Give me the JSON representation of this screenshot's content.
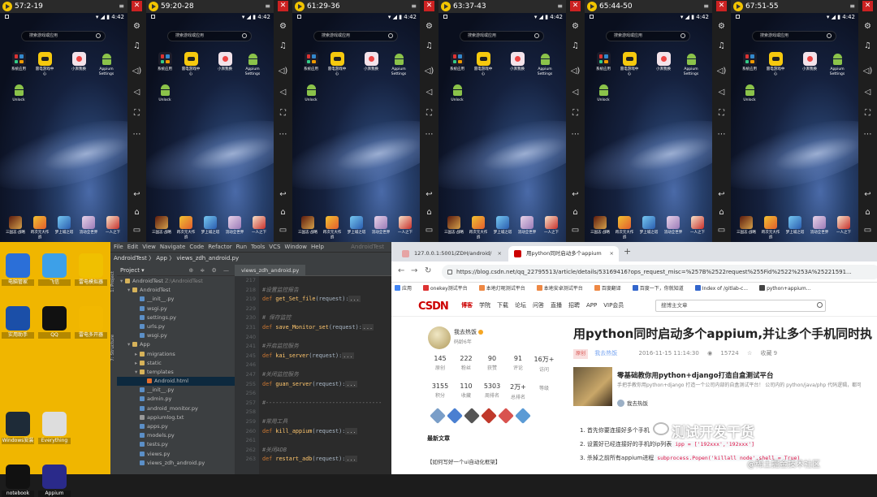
{
  "emulators": [
    {
      "title": "57:2-19",
      "time": "4:42"
    },
    {
      "title": "59:20-28",
      "time": "4:42"
    },
    {
      "title": "61:29-36",
      "time": "4:42"
    },
    {
      "title": "63:37-43",
      "time": "4:42"
    },
    {
      "title": "65:44-50",
      "time": "4:42"
    },
    {
      "title": "67:51-55",
      "time": "4:42"
    }
  ],
  "android": {
    "search_placeholder": "搜索游戏或应用",
    "apps": [
      "系统应用",
      "雷电游戏中心",
      "小湃我换",
      "Appium Settings",
      "Unlock"
    ],
    "dock": [
      "三国志·战略",
      "跨次元大作战",
      "梦上城之塔",
      "流动全世界",
      "一人之下"
    ]
  },
  "desktop": {
    "icons": [
      "电脑管家",
      "飞信",
      "雷电模拟器",
      "实用助手",
      "QQ",
      "雷电多开器",
      "Windows安装",
      "Everything",
      "notebook",
      "Appium"
    ]
  },
  "ide": {
    "menu": [
      "File",
      "Edit",
      "View",
      "Navigate",
      "Code",
      "Refactor",
      "Run",
      "Tools",
      "VCS",
      "Window",
      "Help"
    ],
    "menu_right": "AndroidTest",
    "crumbs": "AndroidTest 〉 App 〉 views_zdh_android.py",
    "project_label": "Project",
    "tree": [
      {
        "name": "AndroidTest",
        "sub": "Z:\\AndroidTest",
        "type": "folder",
        "indent": 0,
        "arrow": "▾"
      },
      {
        "name": "AndroidTest",
        "type": "folder",
        "indent": 1,
        "arrow": "▾"
      },
      {
        "name": "__init__.py",
        "type": "py",
        "indent": 2,
        "arrow": ""
      },
      {
        "name": "wsgi.py",
        "type": "py",
        "indent": 2,
        "arrow": ""
      },
      {
        "name": "settings.py",
        "type": "py",
        "indent": 2,
        "arrow": ""
      },
      {
        "name": "urls.py",
        "type": "py",
        "indent": 2,
        "arrow": ""
      },
      {
        "name": "wsgi.py",
        "type": "py",
        "indent": 2,
        "arrow": ""
      },
      {
        "name": "App",
        "type": "folder",
        "indent": 1,
        "arrow": "▾"
      },
      {
        "name": "migrations",
        "type": "folder",
        "indent": 2,
        "arrow": "▸"
      },
      {
        "name": "static",
        "type": "folder",
        "indent": 2,
        "arrow": "▸"
      },
      {
        "name": "templates",
        "type": "folder",
        "indent": 2,
        "arrow": "▾"
      },
      {
        "name": "Android.html",
        "type": "html",
        "indent": 3,
        "arrow": ""
      },
      {
        "name": "__init__.py",
        "type": "py",
        "indent": 2,
        "arrow": ""
      },
      {
        "name": "admin.py",
        "type": "py",
        "indent": 2,
        "arrow": ""
      },
      {
        "name": "android_monitor.py",
        "type": "py",
        "indent": 2,
        "arrow": ""
      },
      {
        "name": "appiumlog.txt",
        "type": "txt",
        "indent": 2,
        "arrow": ""
      },
      {
        "name": "apps.py",
        "type": "py",
        "indent": 2,
        "arrow": ""
      },
      {
        "name": "models.py",
        "type": "py",
        "indent": 2,
        "arrow": ""
      },
      {
        "name": "tests.py",
        "type": "py",
        "indent": 2,
        "arrow": ""
      },
      {
        "name": "views.py",
        "type": "py",
        "indent": 2,
        "arrow": ""
      },
      {
        "name": "views_zdh_android.py",
        "type": "py",
        "indent": 2,
        "arrow": ""
      }
    ],
    "selected_index": 11,
    "editor_tab": "views_zdh_android.py",
    "line_numbers": [
      "217",
      "218",
      "219",
      "229",
      "230",
      "231",
      "240",
      "241",
      "245",
      "246",
      "247",
      "255",
      "256",
      "257",
      "258",
      "259",
      "260",
      "261",
      "262",
      "263"
    ],
    "code": [
      "",
      "#设置监控报告",
      "def get_Set_file(request):",
      "",
      "# 保存监控",
      "def save_Monitor_set(request):",
      "",
      "#开启监控服务",
      "def kai_server(request):",
      "",
      "#关闭监控服务",
      "def guan_server(request):",
      "",
      "#-----------------------------------",
      "",
      "#常用工具",
      "def kill_appium(request):",
      "",
      "#关闭ADB",
      "def restart_adb(request):"
    ]
  },
  "browser": {
    "tabs": [
      {
        "title": "127.0.0.1:5001/ZDH/android/",
        "active": false
      },
      {
        "title": "用python同时启动多个appium",
        "active": true
      }
    ],
    "url": "https://blog.csdn.net/qq_22795513/article/details/53169416?ops_request_misc=%257B%2522request%255Fid%2522%253A%25221591...",
    "bookmarks": [
      "应用",
      "onekey测试平台",
      "本地灯呢测试平台",
      "本地安卓测试平台",
      "百度翻译",
      "百度一下，你就知道",
      "Index of /gitlab-c...",
      "python+appium..."
    ],
    "csdn_nav": [
      "博客",
      "学院",
      "下载",
      "论坛",
      "问答",
      "直播",
      "招聘",
      "APP",
      "VIP会员"
    ],
    "search_placeholder": "搜博主文章",
    "author": "我去热饭",
    "author_age": "码龄6年",
    "stats": [
      {
        "n": "145",
        "l": "原创"
      },
      {
        "n": "222",
        "l": "粉丝"
      },
      {
        "n": "90",
        "l": "获赞"
      },
      {
        "n": "91",
        "l": "评论"
      },
      {
        "n": "16万+",
        "l": "访问"
      },
      {
        "n": "3155",
        "l": "积分"
      },
      {
        "n": "110",
        "l": "收藏"
      },
      {
        "n": "5303",
        "l": "周排名"
      },
      {
        "n": "2万+",
        "l": "总排名"
      },
      {
        "n": "",
        "l": "等级"
      }
    ],
    "latest_title": "最新文章",
    "latest_item": "【如何写好一个ui自动化框架】",
    "article_title": "用python同时启动多个appium,并让多个手机同时执",
    "meta_orig": "原创",
    "meta_author": "我去热饭",
    "meta_date": "2016-11-15 11:14:30",
    "meta_views": "15724",
    "meta_collect": "收藏 9",
    "promo_title": "零基础教你用python+django打造自盒测试平台",
    "promo_desc": "手把手教你用python+django 打造一个公司内部的自盒测试平台！ 公司内的 python/java/php 代码逻辑，都可以放在这个平台上进行管理和自盒测试了，主要...",
    "promo_author": "我去热饭",
    "steps": [
      "1. 首先你要连接好多个手机",
      "2. 设置好已经连接好的手机的ip列表",
      "3. 杀掉之前所有appium进程"
    ],
    "step_codes": [
      "",
      "ipp = ['192xxx','192xxx']",
      "subprocess.Popen('killall node',shell = True)"
    ],
    "watermark": "测试开发干货",
    "watermark2": "@稀土掘金技术社区"
  }
}
